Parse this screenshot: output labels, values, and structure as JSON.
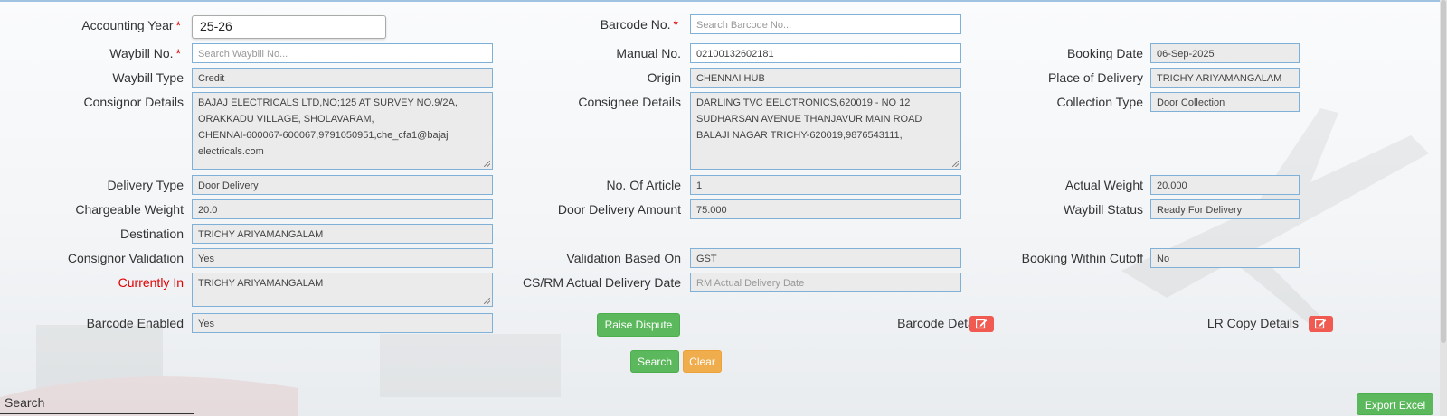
{
  "form": {
    "accounting_year": {
      "label": "Accounting Year",
      "value": "25-26"
    },
    "barcode_no": {
      "label": "Barcode No.",
      "placeholder": "Search Barcode No..."
    },
    "waybill_no": {
      "label": "Waybill No.",
      "placeholder": "Search Waybill No..."
    },
    "manual_no": {
      "label": "Manual No.",
      "value": "02100132602181"
    },
    "booking_date": {
      "label": "Booking Date",
      "value": "06-Sep-2025"
    },
    "waybill_type": {
      "label": "Waybill Type",
      "value": "Credit"
    },
    "origin": {
      "label": "Origin",
      "value": "CHENNAI HUB"
    },
    "place_of_delivery": {
      "label": "Place of Delivery",
      "value": "TRICHY ARIYAMANGALAM"
    },
    "consignor_details": {
      "label": "Consignor Details",
      "value": "BAJAJ ELECTRICALS LTD,NO;125 AT SURVEY NO.9/2A,\nORAKKADU VILLAGE, SHOLAVARAM,\nCHENNAI-600067-600067,9791050951,che_cfa1@bajaj\nelectricals.com"
    },
    "consignee_details": {
      "label": "Consignee Details",
      "value": "DARLING TVC EELCTRONICS,620019 - NO 12\nSUDHARSAN AVENUE THANJAVUR MAIN ROAD\nBALAJI NAGAR TRICHY-620019,9876543111,"
    },
    "collection_type": {
      "label": "Collection Type",
      "value": "Door Collection"
    },
    "delivery_type": {
      "label": "Delivery Type",
      "value": "Door Delivery"
    },
    "no_of_article": {
      "label": "No. Of Article",
      "value": "1"
    },
    "actual_weight": {
      "label": "Actual Weight",
      "value": "20.000"
    },
    "chargeable_weight": {
      "label": "Chargeable Weight",
      "value": "20.0"
    },
    "door_delivery_amount": {
      "label": "Door Delivery Amount",
      "value": "75.000"
    },
    "waybill_status": {
      "label": "Waybill Status",
      "value": "Ready For Delivery"
    },
    "destination": {
      "label": "Destination",
      "value": "TRICHY ARIYAMANGALAM"
    },
    "consignor_validation": {
      "label": "Consignor Validation",
      "value": "Yes"
    },
    "validation_based_on": {
      "label": "Validation Based On",
      "value": "GST"
    },
    "booking_within_cutoff": {
      "label": "Booking Within Cutoff",
      "value": "No"
    },
    "currently_in": {
      "label": "Currently In",
      "value": "TRICHY ARIYAMANGALAM"
    },
    "cs_rm_actual_delivery_date": {
      "label": "CS/RM Actual Delivery Date",
      "placeholder": "RM Actual Delivery Date"
    },
    "barcode_enabled": {
      "label": "Barcode Enabled",
      "value": "Yes"
    },
    "barcode_details": {
      "label": "Barcode Details"
    },
    "lr_copy_details": {
      "label": "LR Copy Details"
    }
  },
  "required_marker": "*",
  "buttons": {
    "raise_dispute": "Raise Dispute",
    "search": "Search",
    "clear": "Clear",
    "export_excel": "Export Excel"
  },
  "table_search": {
    "label": "Search"
  },
  "icons": {
    "edit": "edit-icon"
  },
  "colors": {
    "accent_green": "#5cb85c",
    "accent_orange": "#f0ad4e",
    "edit_red": "#f05a50",
    "required_red": "#e00000",
    "field_border": "#7fb0d8"
  }
}
